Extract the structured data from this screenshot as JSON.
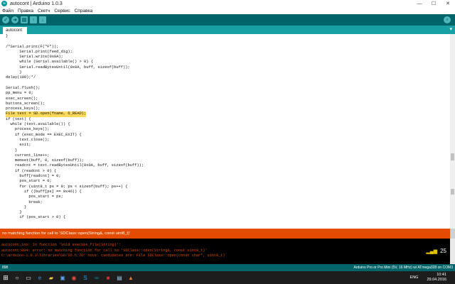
{
  "window": {
    "title": "autocont | Arduino 1.0.3",
    "minimize": "—",
    "maximize": "☐",
    "close": "✕"
  },
  "menu": [
    "Файл",
    "Правка",
    "Скетч",
    "Сервис",
    "Справка"
  ],
  "toolbar": {
    "verify": "✓",
    "upload": "➜",
    "new": "▤",
    "open": "↑",
    "save": "↓",
    "serial": "⌕"
  },
  "tab": {
    "name": "autocont",
    "menu": "▾"
  },
  "code_lines": [
    "}",
    "",
    "/*Serial.print(F(\"F\"));",
    "      Serial.print(feed_dig);",
    "      Serial.write(0x0A);",
    "      while (Serial.available() > 0) {",
    "      Serial.readBytesUntil(0x0A, buff, sizeof(buff));",
    "      }",
    "delay(100);*/",
    "",
    "Serial.flush();",
    "pp_menu = 0;",
    "exec_screen();",
    "buttons_screen();",
    "process_keys();",
    "File text = SD.open(fname, O_READ);",
    "if (text) {",
    "  while (text.available()) {",
    "    process_keys();",
    "    if (exec_mode == EXEC_EXIT) {",
    "      text.close();",
    "      exit;",
    "    }",
    "    current_line++;",
    "    memset(buff, 0, sizeof(buff));",
    "    readcnt = text.readBytesUntil(0x0A, buff, sizeof(buff));",
    "    if (readcnt > 0) {",
    "      buff[readcnt] = 0;",
    "      pos_start = 0;",
    "      for (uint8_t ps = 0; ps < sizeof(buff); ps++) {",
    "        if ((buff[ps] == 0x46)) {",
    "          pos_start = ps;",
    "          break;",
    "        }",
    "      }",
    "      if (pos_start > 0) {"
  ],
  "highlight_line": 15,
  "status_message": "no matching function for call to 'SDClass::open(String&, const uint8_t)'",
  "console_lines": [
    "autocont.ino: In function 'void execute_file(String)':",
    "autocont:894: error: no matching function for call to 'SDClass::open(String&, const uint8_t)'",
    "C:\\arduino-1.0.3\\libraries\\SD/SD.h:76: note: candidates are: File SDClass::open(const char*, uint8_t)"
  ],
  "console_count": "25",
  "line_number": "898",
  "board_info": "Arduino Pro or Pro Mini (5V, 16 MHz) w/ ATmega328 on COM3",
  "taskbar": {
    "icons": [
      "search-icon",
      "task-view-icon",
      "edge-icon",
      "explorer-icon",
      "store-icon",
      "chrome-icon",
      "skype-icon",
      "arduino-icon",
      "app-icon",
      "notepad-icon",
      "app-icon"
    ],
    "language": "ENG",
    "time": "10:41",
    "date": "29.04.2016"
  },
  "colors": {
    "toolbar": "#006468",
    "tabbar": "#17a1a5",
    "error": "#e34c00",
    "highlight": "#ffd95a",
    "console_bg": "#000000"
  }
}
